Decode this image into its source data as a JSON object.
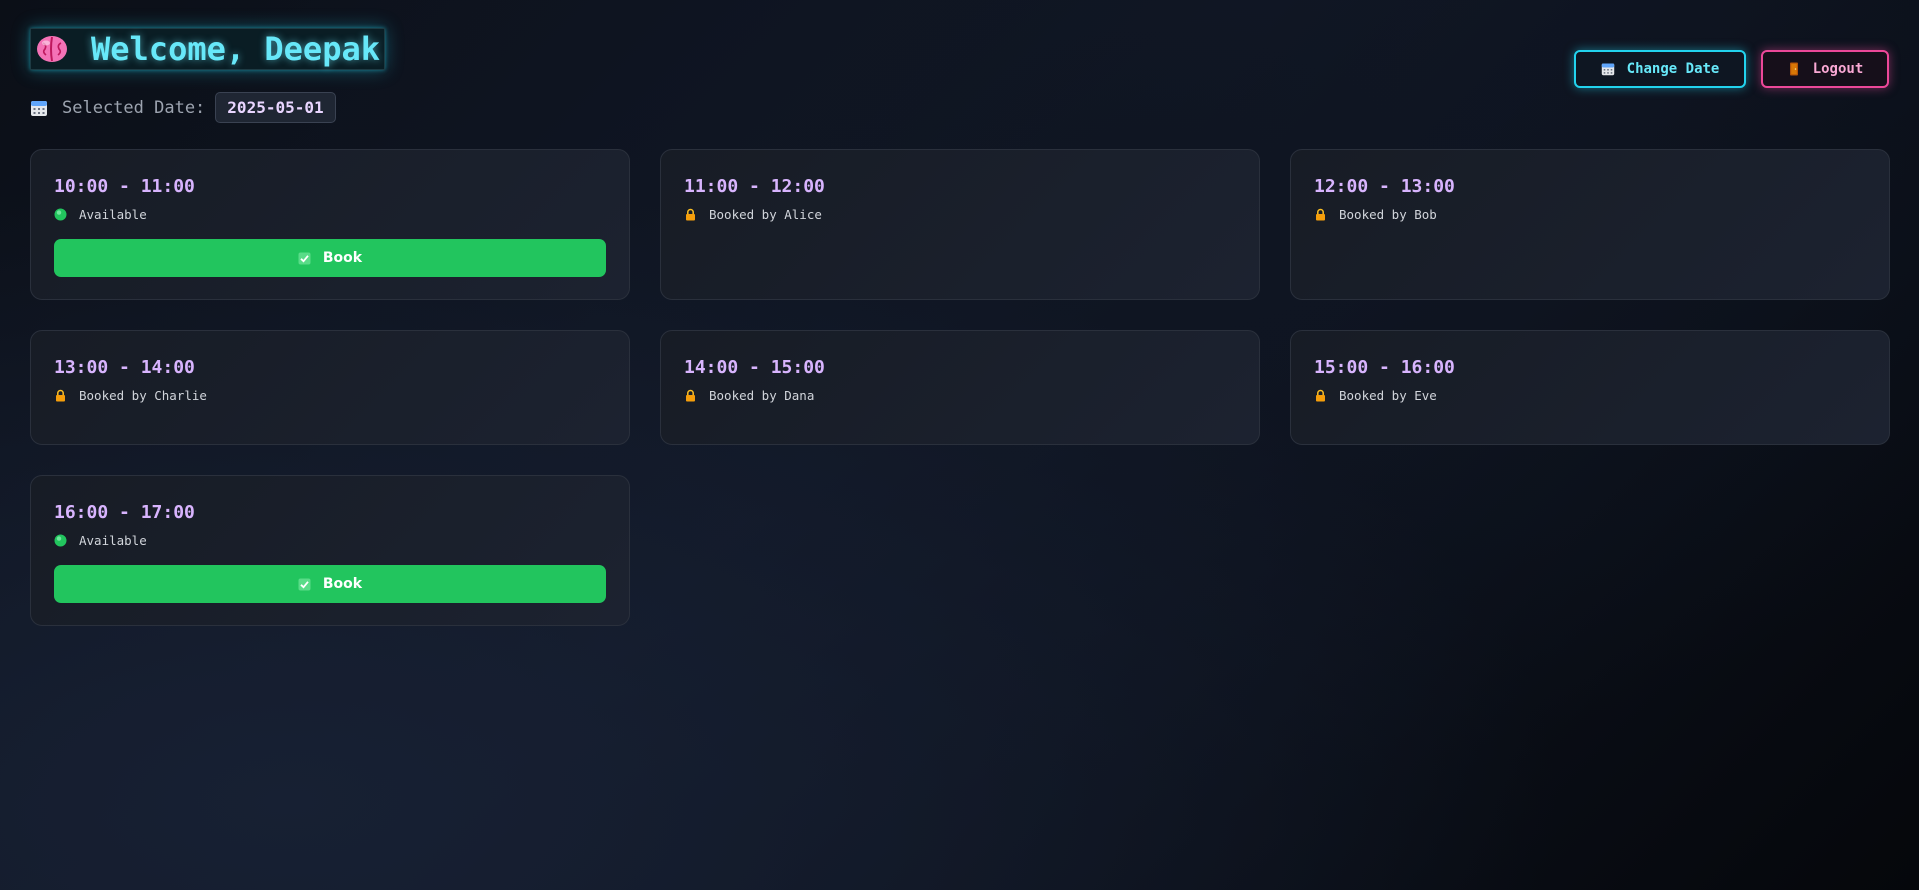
{
  "header": {
    "welcome_text": "Welcome, Deepak",
    "brain_icon": "brain-icon",
    "date_label": "Selected Date:",
    "date_value": "2025-05-01"
  },
  "actions": {
    "change_date_label": "Change Date",
    "logout_label": "Logout"
  },
  "colors": {
    "accent_cyan": "#22d3ee",
    "accent_pink": "#ec4899",
    "available_green": "#22c55e",
    "time_purple": "#d8b4fe"
  },
  "slots": [
    {
      "time": "10:00 - 11:00",
      "status": "Available",
      "available": true,
      "book_label": "Book"
    },
    {
      "time": "11:00 - 12:00",
      "status": "Booked by Alice",
      "available": false
    },
    {
      "time": "12:00 - 13:00",
      "status": "Booked by Bob",
      "available": false
    },
    {
      "time": "13:00 - 14:00",
      "status": "Booked by Charlie",
      "available": false
    },
    {
      "time": "14:00 - 15:00",
      "status": "Booked by Dana",
      "available": false
    },
    {
      "time": "15:00 - 16:00",
      "status": "Booked by Eve",
      "available": false
    },
    {
      "time": "16:00 - 17:00",
      "status": "Available",
      "available": true,
      "book_label": "Book"
    }
  ]
}
